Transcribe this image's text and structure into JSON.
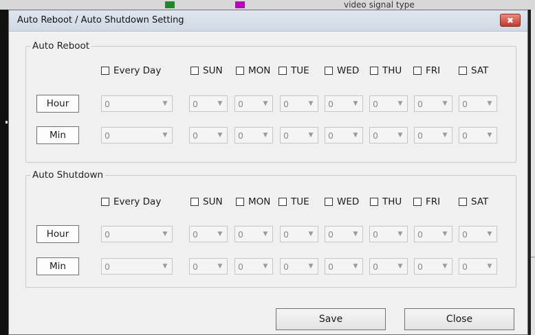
{
  "window": {
    "title": "Auto Reboot / Auto Shutdown Setting",
    "close_glyph": "✖"
  },
  "background": {
    "partial_text": "video signal type"
  },
  "days": [
    "SUN",
    "MON",
    "TUE",
    "WED",
    "THU",
    "FRI",
    "SAT"
  ],
  "every_day_label": "Every Day",
  "reboot": {
    "legend": "Auto Reboot",
    "hour_label": "Hour",
    "min_label": "Min",
    "hour_values": [
      "0",
      "0",
      "0",
      "0",
      "0",
      "0",
      "0",
      "0"
    ],
    "min_values": [
      "0",
      "0",
      "0",
      "0",
      "0",
      "0",
      "0",
      "0"
    ]
  },
  "shutdown": {
    "legend": "Auto Shutdown",
    "hour_label": "Hour",
    "min_label": "Min",
    "hour_values": [
      "0",
      "0",
      "0",
      "0",
      "0",
      "0",
      "0",
      "0"
    ],
    "min_values": [
      "0",
      "0",
      "0",
      "0",
      "0",
      "0",
      "0",
      "0"
    ]
  },
  "buttons": {
    "save": "Save",
    "close": "Close"
  },
  "icons": {
    "checkbox": "checkbox-icon",
    "dropdown": "dropdown-arrow-icon",
    "close": "close-icon"
  },
  "colors": {
    "dialog_bg": "#f0f0f0",
    "close_button": "#c4392a",
    "disabled_text": "#8a8a8a"
  }
}
